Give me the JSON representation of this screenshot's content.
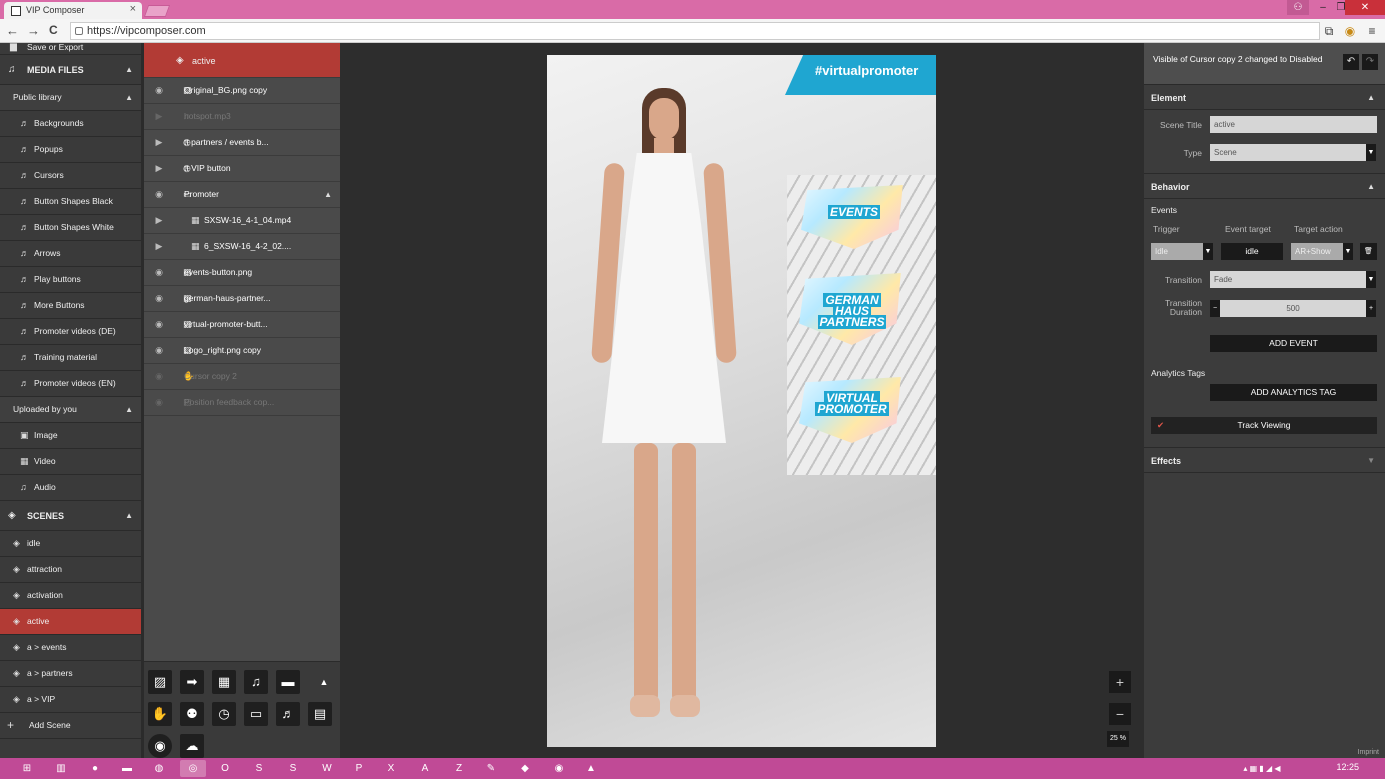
{
  "browser": {
    "tab_title": "VIP Composer",
    "tab_close": "×",
    "url": "https://vipcomposer.com",
    "back": "←",
    "forward": "→",
    "reload": "C",
    "menu": "≡",
    "win_min": "–",
    "win_max": "❐",
    "win_close": "✕"
  },
  "left": {
    "save_export": "Save or Export",
    "media_files": "MEDIA FILES",
    "public_library": "Public library",
    "public_items": [
      "Backgrounds",
      "Popups",
      "Cursors",
      "Button Shapes Black",
      "Button Shapes White",
      "Arrows",
      "Play buttons",
      "More Buttons",
      "Promoter videos (DE)",
      "Training material",
      "Promoter videos (EN)"
    ],
    "uploaded_by_you": "Uploaded by you",
    "uploaded_items": [
      "Image",
      "Video",
      "Audio"
    ],
    "scenes_title": "SCENES",
    "scenes": [
      "idle",
      "attraction",
      "activation",
      "active",
      "a > events",
      "a > partners",
      "a > VIP"
    ],
    "active_scene_index": 3,
    "add_scene": "Add Scene"
  },
  "layers": {
    "header": "active",
    "items": [
      {
        "label": "Original_BG.png copy",
        "dim": false,
        "ctl": "eye"
      },
      {
        "label": "hotspot.mp3",
        "dim": true,
        "ctl": "play"
      },
      {
        "label": "tt partners / events b...",
        "dim": false,
        "ctl": "play"
      },
      {
        "label": "tt VIP button",
        "dim": false,
        "ctl": "play"
      },
      {
        "label": "Promoter",
        "dim": false,
        "ctl": "eye"
      },
      {
        "label": "SXSW-16_4-1_04.mp4",
        "dim": false,
        "ctl": "play",
        "indent": true
      },
      {
        "label": "6_SXSW-16_4-2_02....",
        "dim": false,
        "ctl": "play",
        "indent": true
      },
      {
        "label": "events-button.png",
        "dim": false,
        "ctl": "eye"
      },
      {
        "label": "german-haus-partner...",
        "dim": false,
        "ctl": "eye"
      },
      {
        "label": "virtual-promoter-butt...",
        "dim": false,
        "ctl": "eye"
      },
      {
        "label": "Logo_right.png copy",
        "dim": false,
        "ctl": "eye"
      },
      {
        "label": "Cursor copy 2",
        "dim": true,
        "ctl": "eye"
      },
      {
        "label": "Position feedback cop...",
        "dim": true,
        "ctl": "eye"
      }
    ]
  },
  "canvas": {
    "hashtag": "#virtualpromoter",
    "buttons": [
      {
        "lines": [
          "EVENTS"
        ]
      },
      {
        "lines": [
          "GERMAN",
          "HAUS",
          "PARTNERS"
        ]
      },
      {
        "lines": [
          "VIRTUAL",
          "PROMOTER"
        ]
      }
    ],
    "zoom_in": "+",
    "zoom_out": "−",
    "zoom_level": "25 %"
  },
  "props": {
    "notice": "Visible of Cursor copy 2 changed to Disabled",
    "element_title": "Element",
    "scene_title_label": "Scene Title",
    "scene_title_value": "active",
    "type_label": "Type",
    "type_value": "Scene",
    "behavior_title": "Behavior",
    "events_label": "Events",
    "trigger_label": "Trigger",
    "event_target_label": "Event target",
    "target_action_label": "Target action",
    "trigger_value": "Idle",
    "event_target_value": "idle",
    "target_action_value": "AR+Show",
    "transition_label": "Transition",
    "transition_value": "Fade",
    "transition_duration_label": "Transition Duration",
    "transition_duration_value": "500",
    "add_event": "ADD EVENT",
    "analytics_tags": "Analytics Tags",
    "add_analytics_tag": "ADD ANALYTICS TAG",
    "track_viewing": "Track Viewing",
    "effects_title": "Effects",
    "imprint": "Imprint"
  },
  "taskbar": {
    "clock": "12:25"
  }
}
